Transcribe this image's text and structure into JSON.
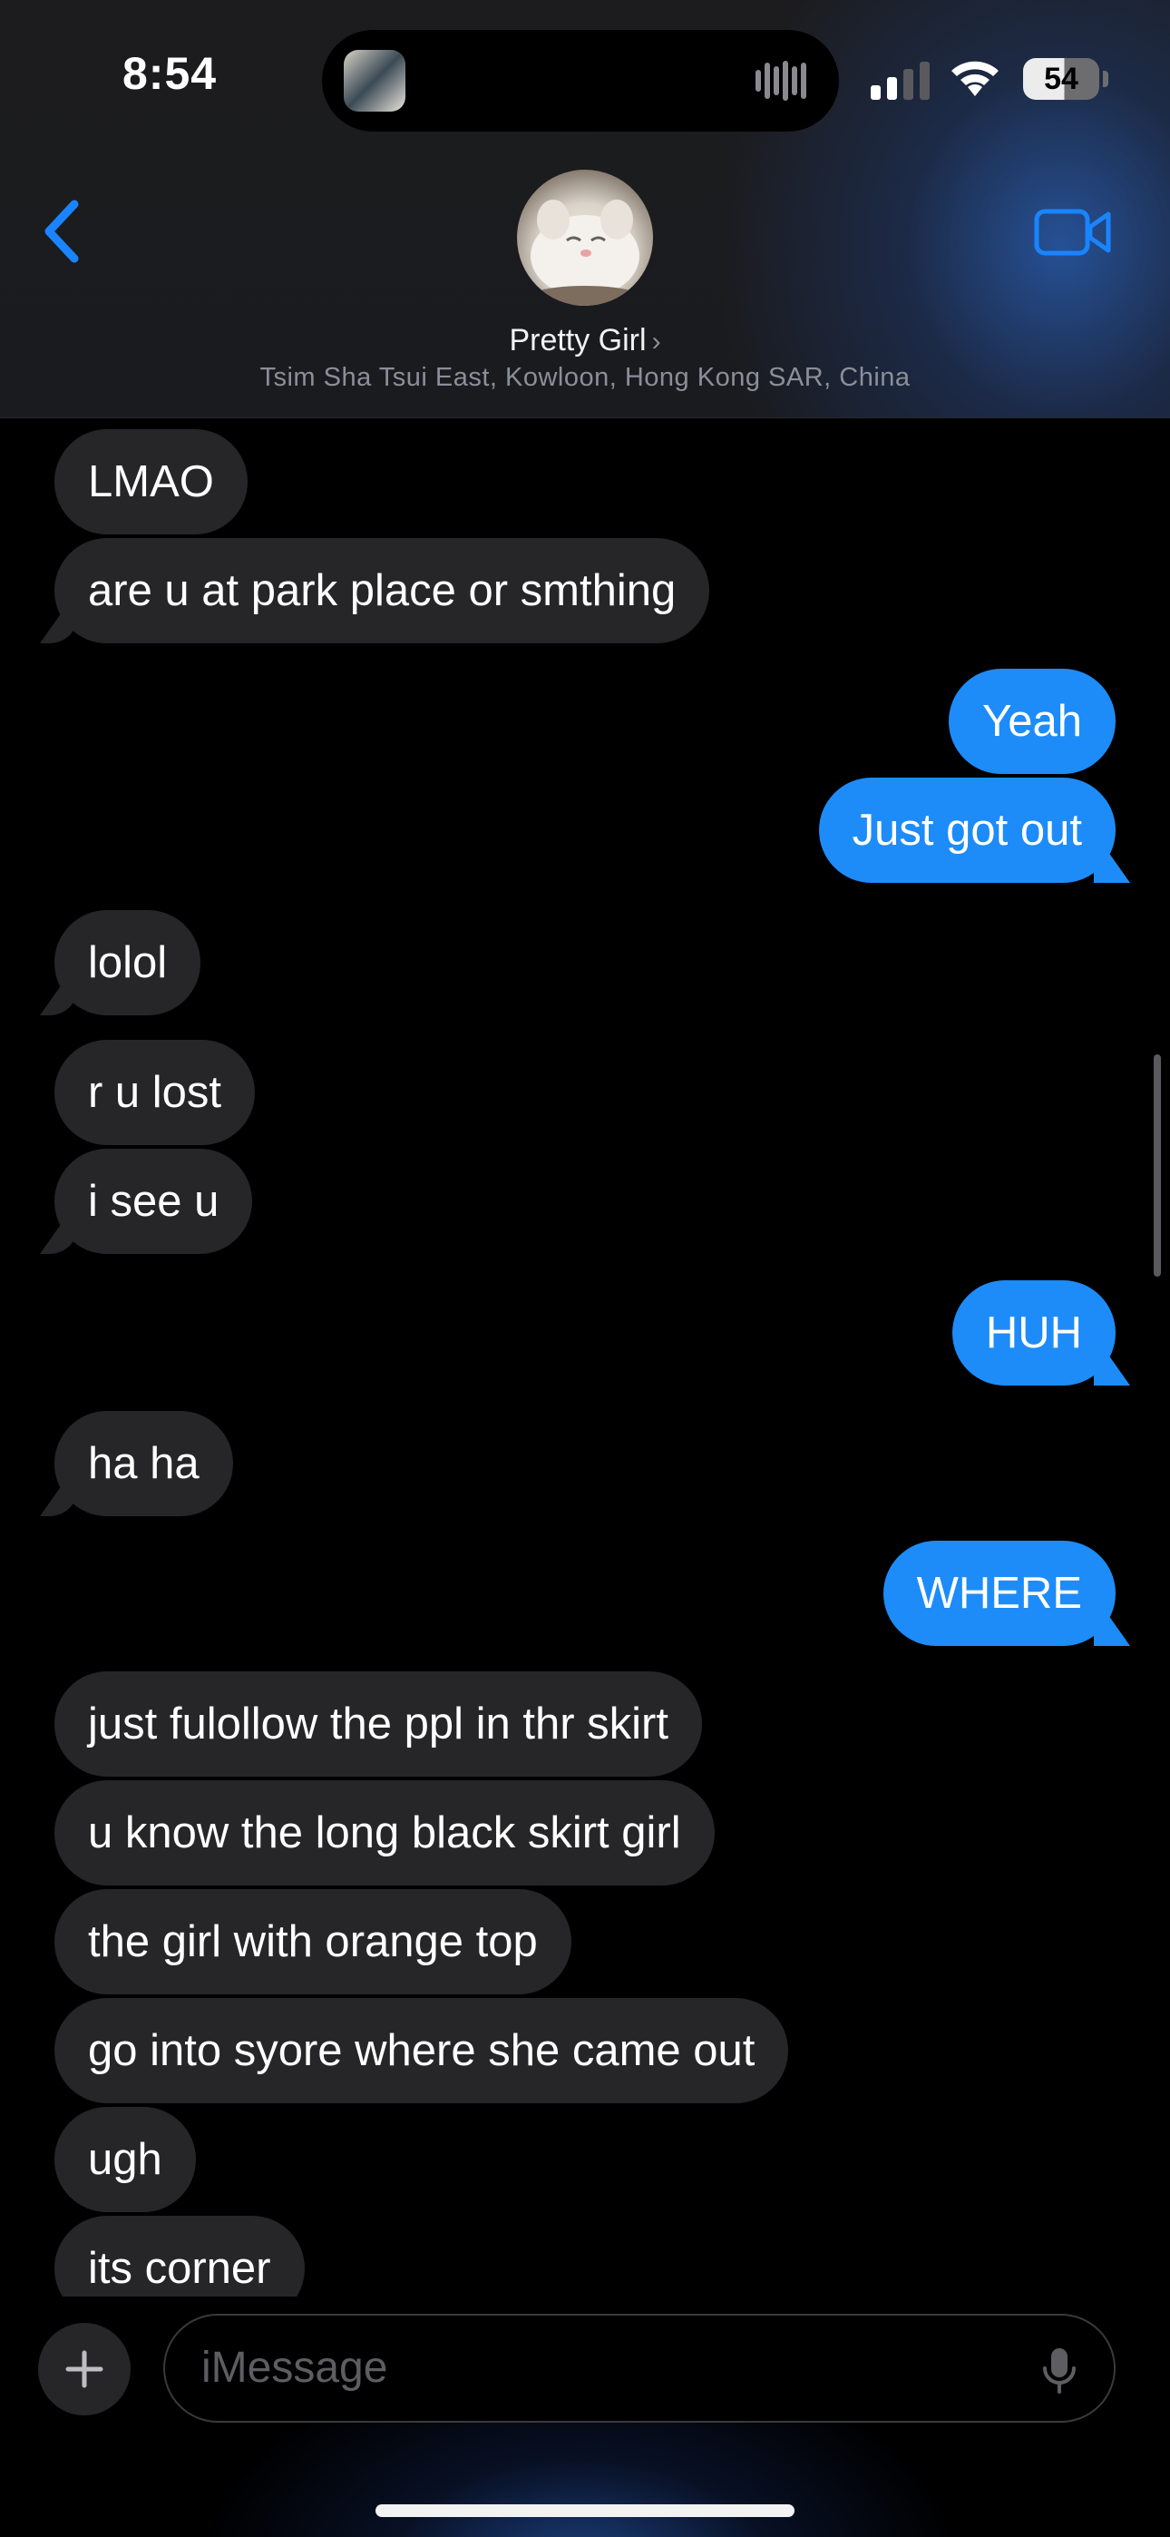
{
  "status_bar": {
    "time": "8:54",
    "battery": "54"
  },
  "header": {
    "contact_name": "Pretty Girl",
    "contact_chevron": "›",
    "location": "Tsim Sha Tsui East, Kowloon, Hong Kong SAR, China",
    "back_icon": "chevron-left-icon",
    "video_icon": "video-camera-icon"
  },
  "colors": {
    "outgoing_bubble": "#1d8cf8",
    "incoming_bubble": "#262628",
    "accent": "#1a84ff"
  },
  "messages": [
    {
      "text": "LMAO",
      "from": "them"
    },
    {
      "text": "are u at park place or smthing",
      "from": "them"
    },
    {
      "text": "Yeah",
      "from": "me"
    },
    {
      "text": "Just got out",
      "from": "me"
    },
    {
      "text": "lolol",
      "from": "them"
    },
    {
      "text": "r u lost",
      "from": "them"
    },
    {
      "text": "i see u",
      "from": "them"
    },
    {
      "text": "HUH",
      "from": "me"
    },
    {
      "text": "ha ha",
      "from": "them"
    },
    {
      "text": "WHERE",
      "from": "me"
    },
    {
      "text": "just fulollow the ppl in thr skirt",
      "from": "them"
    },
    {
      "text": "u know the long black skirt girl",
      "from": "them"
    },
    {
      "text": "the girl with orange top",
      "from": "them"
    },
    {
      "text": "go into syore where she came out",
      "from": "them"
    },
    {
      "text": "ugh",
      "from": "them"
    },
    {
      "text": "its corner",
      "from": "them"
    }
  ],
  "composer": {
    "placeholder": "iMessage",
    "plus_icon": "plus-icon",
    "mic_icon": "microphone-icon"
  }
}
